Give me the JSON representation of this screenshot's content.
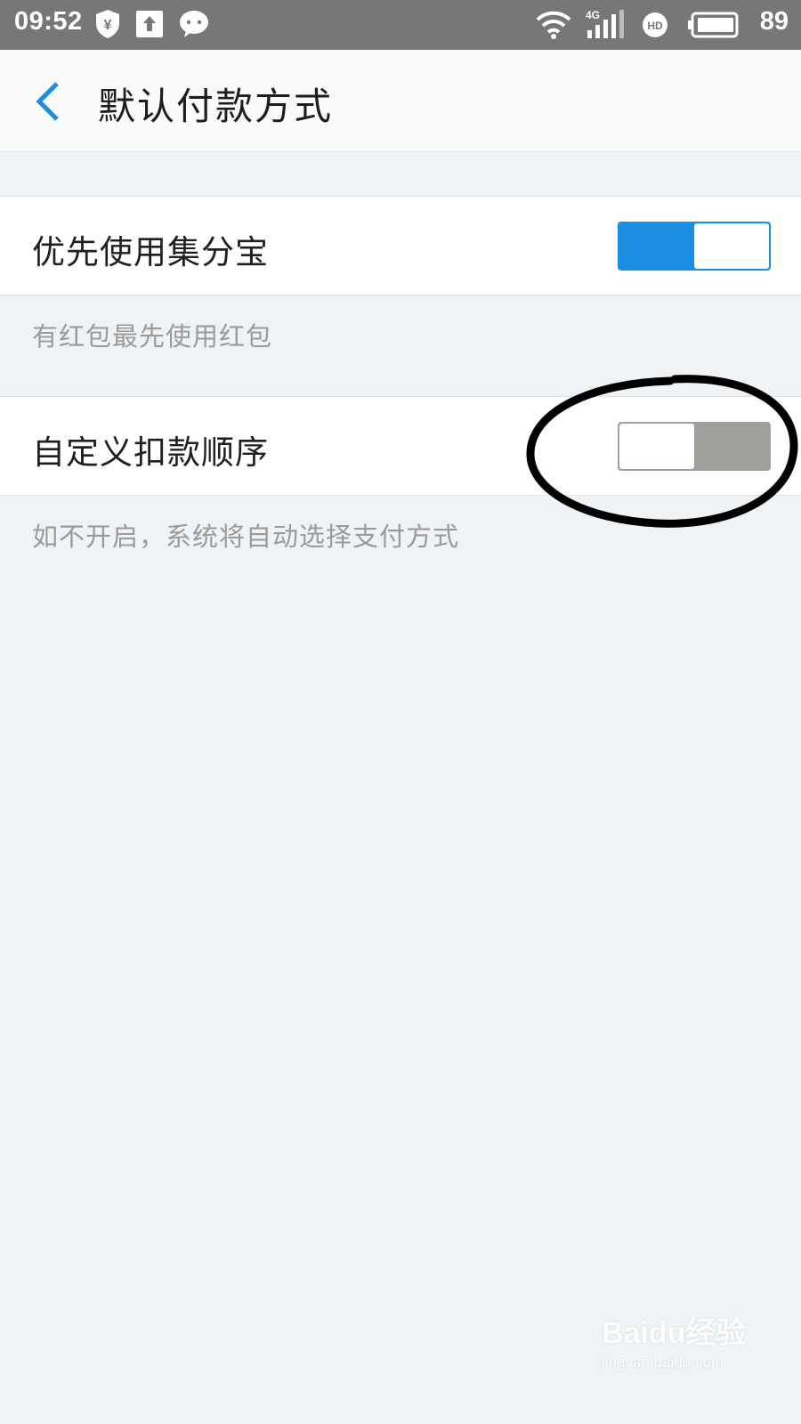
{
  "status_bar": {
    "time": "09:52",
    "battery_level": "89",
    "network": "4G",
    "icons": [
      "shield-yen-icon",
      "upload-icon",
      "wechat-icon",
      "wifi-icon",
      "signal-4g-icon",
      "hd-icon",
      "battery-icon"
    ]
  },
  "header": {
    "back_icon": "chevron-left-icon",
    "title": "默认付款方式"
  },
  "settings": [
    {
      "label": "优先使用集分宝",
      "enabled": true,
      "hint": "有红包最先使用红包"
    },
    {
      "label": "自定义扣款顺序",
      "enabled": false,
      "hint": "如不开启，系统将自动选择支付方式"
    }
  ],
  "watermark": {
    "logo": "Baidu经验",
    "url": "jingyan.baidu.com"
  },
  "colors": {
    "accent": "#1a8ee3",
    "toggle_off": "#9ea09b",
    "background": "#f0f3f6",
    "status_bar": "#777777"
  }
}
